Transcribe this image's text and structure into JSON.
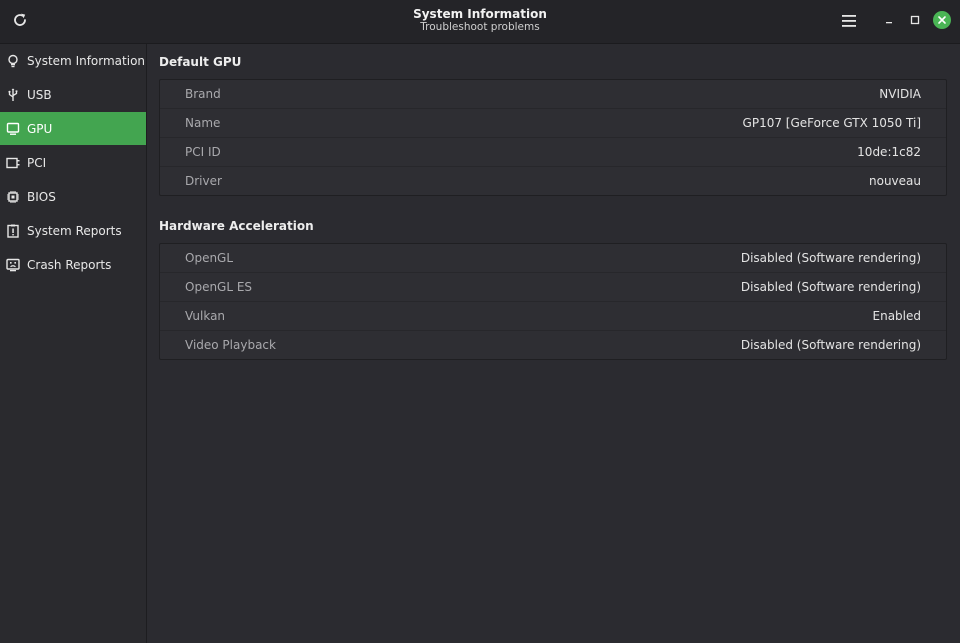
{
  "window": {
    "title": "System Information",
    "subtitle": "Troubleshoot problems"
  },
  "icons": {
    "refresh": "refresh-icon",
    "menu": "hamburger-menu-icon",
    "minimize": "minimize-icon",
    "maximize": "maximize-icon",
    "close": "close-icon"
  },
  "colors": {
    "accent": "#43a550",
    "close": "#4ab555"
  },
  "sidebar": {
    "items": [
      {
        "label": "System Information",
        "icon": "lightbulb-icon",
        "active": false
      },
      {
        "label": "USB",
        "icon": "usb-icon",
        "active": false
      },
      {
        "label": "GPU",
        "icon": "monitor-icon",
        "active": true
      },
      {
        "label": "PCI",
        "icon": "pci-card-icon",
        "active": false
      },
      {
        "label": "BIOS",
        "icon": "chip-icon",
        "active": false
      },
      {
        "label": "System Reports",
        "icon": "report-icon",
        "active": false
      },
      {
        "label": "Crash Reports",
        "icon": "crash-face-icon",
        "active": false
      }
    ]
  },
  "sections": [
    {
      "title": "Default GPU",
      "rows": [
        {
          "label": "Brand",
          "value": "NVIDIA"
        },
        {
          "label": "Name",
          "value": "GP107 [GeForce GTX 1050 Ti]"
        },
        {
          "label": "PCI ID",
          "value": "10de:1c82"
        },
        {
          "label": "Driver",
          "value": "nouveau"
        }
      ]
    },
    {
      "title": "Hardware Acceleration",
      "rows": [
        {
          "label": "OpenGL",
          "value": "Disabled (Software rendering)"
        },
        {
          "label": "OpenGL ES",
          "value": "Disabled (Software rendering)"
        },
        {
          "label": "Vulkan",
          "value": "Enabled"
        },
        {
          "label": "Video Playback",
          "value": "Disabled (Software rendering)"
        }
      ]
    }
  ]
}
